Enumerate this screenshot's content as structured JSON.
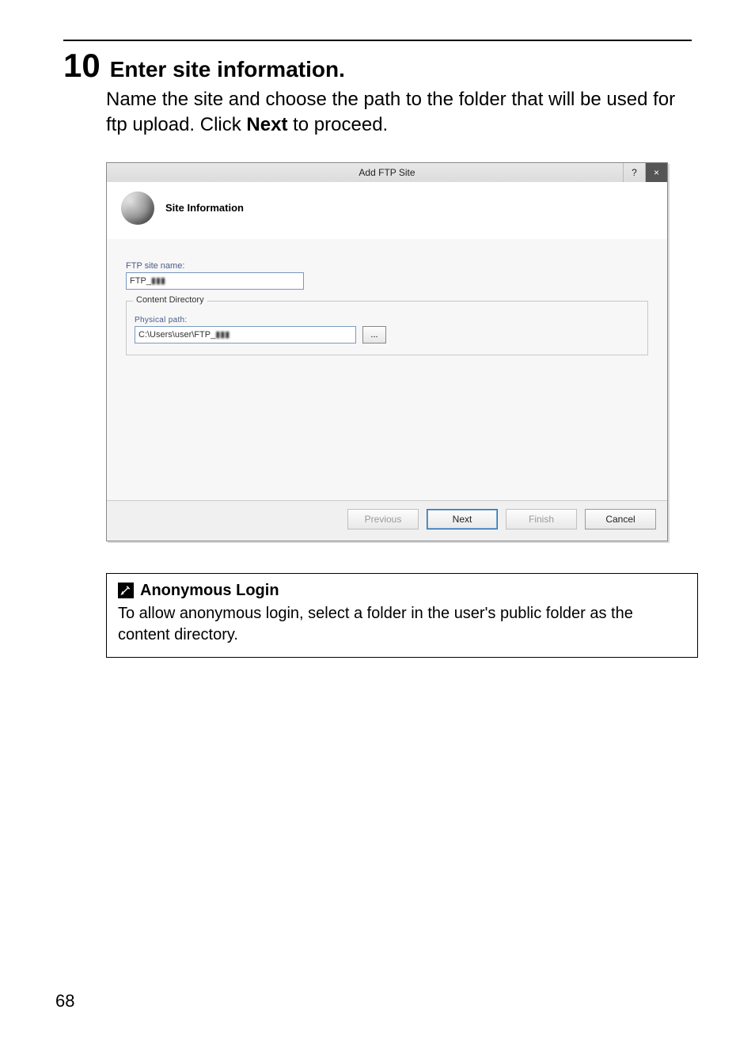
{
  "step": {
    "number": "10",
    "title": "Enter site information.",
    "description_pre": "Name the site and choose the path to the folder that will be used for ftp upload. Click ",
    "description_bold": "Next",
    "description_post": " to proceed."
  },
  "dialog": {
    "title": "Add FTP Site",
    "help_glyph": "?",
    "close_glyph": "×",
    "header": "Site Information",
    "site_name_label": "FTP site name:",
    "site_name_value": "FTP_",
    "content_legend": "Content Directory",
    "physical_label": "Physical path:",
    "physical_value": "C:\\Users\\user\\FTP_",
    "browse_label": "...",
    "buttons": {
      "previous": "Previous",
      "next": "Next",
      "finish": "Finish",
      "cancel": "Cancel"
    }
  },
  "note": {
    "title": "Anonymous Login",
    "text": "To allow anonymous login, select a folder in the user's public folder as the content directory."
  },
  "page_number": "68"
}
